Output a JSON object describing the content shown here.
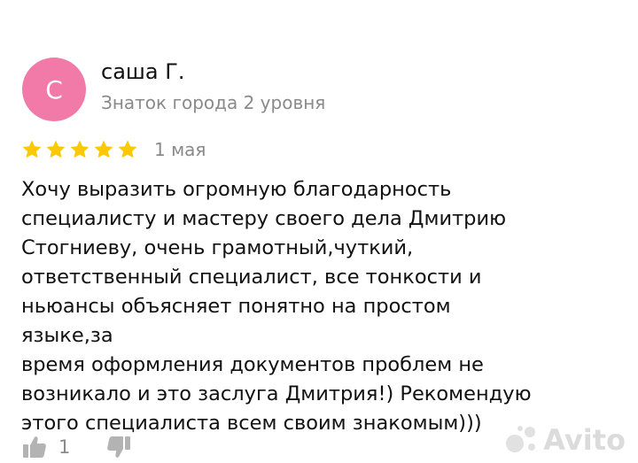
{
  "review": {
    "author": {
      "initial": "С",
      "name": "саша Г.",
      "level": "Знаток города 2 уровня",
      "avatar_color": "#f17aa8"
    },
    "rating": {
      "value": 5,
      "max": 5,
      "color": "#fcc800"
    },
    "date": "1 мая",
    "text": "Хочу выразить огромную благодарность\nспециалисту и мастеру своего дела Дмитрию\nСтогниеву, очень грамотный,чуткий,\nответственный специалист, все тонкости и\nньюансы объясняет понятно на простом языке,за\nвремя оформления документов проблем не\nвозникало и это заслуга Дмитрия!) Рекомендую\nэтого специалиста всем своим знакомым)))",
    "likes": "1",
    "icons": {
      "like": "thumbs-up-icon",
      "dislike": "thumbs-down-icon"
    }
  },
  "watermark": {
    "text": "Avito"
  }
}
